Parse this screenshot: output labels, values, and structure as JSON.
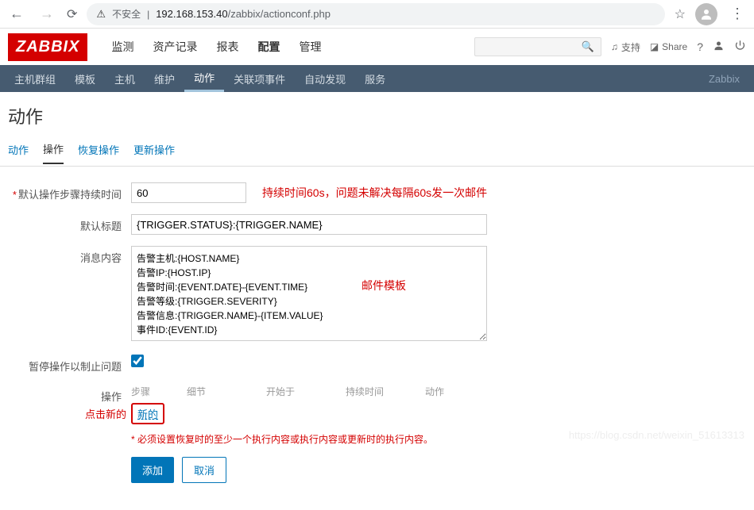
{
  "browser": {
    "security_label": "不安全",
    "url_host": "192.168.153.40",
    "url_path": "/zabbix/actionconf.php"
  },
  "header": {
    "logo": "ZABBIX",
    "nav": [
      "监测",
      "资产记录",
      "报表",
      "配置",
      "管理"
    ],
    "active_nav": "配置",
    "support": "支持",
    "share": "Share",
    "brand_short": "Zabbix"
  },
  "subnav": {
    "items": [
      "主机群组",
      "模板",
      "主机",
      "维护",
      "动作",
      "关联项事件",
      "自动发现",
      "服务"
    ],
    "active": "动作"
  },
  "page": {
    "title": "动作"
  },
  "tabs": {
    "items": [
      "动作",
      "操作",
      "恢复操作",
      "更新操作"
    ],
    "active": "操作"
  },
  "form": {
    "step_duration_label": "默认操作步骤持续时间",
    "step_duration_value": "60",
    "step_duration_annot": "持续时间60s，问题未解决每隔60s发一次邮件",
    "default_title_label": "默认标题",
    "default_title_value": "{TRIGGER.STATUS}:{TRIGGER.NAME}",
    "message_label": "消息内容",
    "message_value": "告警主机:{HOST.NAME}\n告警IP:{HOST.IP}\n告警时间:{EVENT.DATE}-{EVENT.TIME}\n告警等级:{TRIGGER.SEVERITY}\n告警信息:{TRIGGER.NAME}-{ITEM.VALUE}\n事件ID:{EVENT.ID}",
    "message_annot": "邮件模板",
    "pause_label": "暂停操作以制止问题",
    "ops_label": "操作",
    "ops_cols": [
      "步骤",
      "细节",
      "开始于",
      "持续时间",
      "动作"
    ],
    "new_link": "新的",
    "new_annot": "点击新的",
    "hint": "必须设置恢复时的至少一个执行内容或执行内容或更新时的执行内容。",
    "btn_add": "添加",
    "btn_cancel": "取消"
  },
  "watermark": "https://blog.csdn.net/weixin_51613313"
}
